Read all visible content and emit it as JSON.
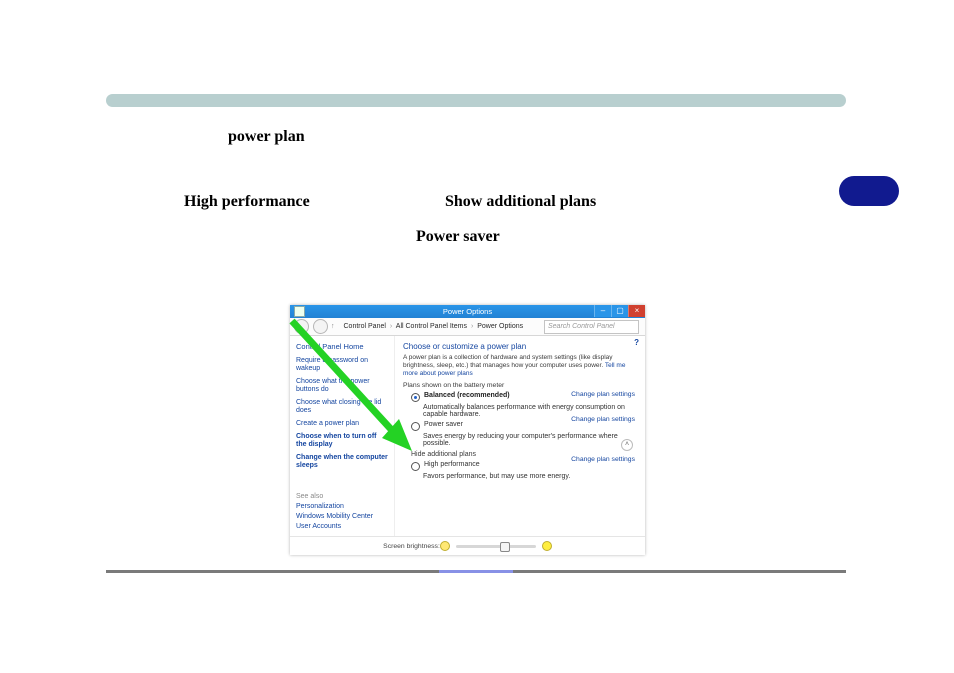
{
  "doc": {
    "line1": "power plan",
    "line2": "High performance",
    "line3": "Show additional plans",
    "line4": "Power saver"
  },
  "ss": {
    "title": "Power Options",
    "winbuttons": {
      "min": "–",
      "max": "▢",
      "close": "×"
    },
    "crumbs": {
      "root": "Control Panel",
      "mid": "All Control Panel Items",
      "leaf": "Power Options"
    },
    "search_placeholder": "Search Control Panel",
    "side": {
      "home": "Control Panel Home",
      "links": [
        "Require a password on wakeup",
        "Choose what the power buttons do",
        "Choose what closing the lid does",
        "Create a power plan",
        "Choose when to turn off the display",
        "Change when the computer sleeps"
      ],
      "see_also": "See also",
      "also_links": [
        "Personalization",
        "Windows Mobility Center",
        "User Accounts"
      ]
    },
    "main": {
      "heading": "Choose or customize a power plan",
      "desc_pre": "A power plan is a collection of hardware and system settings (like display brightness, sleep, etc.) that manages how your computer uses power. ",
      "desc_link": "Tell me more about power plans",
      "section1": "Plans shown on the battery meter",
      "plan_balanced": {
        "name": "Balanced (recommended)",
        "sub": "Automatically balances performance with energy consumption on capable hardware."
      },
      "plan_saver": {
        "name": "Power saver",
        "sub": "Saves energy by reducing your computer's performance where possible."
      },
      "hide_additional": "Hide additional plans",
      "plan_high": {
        "name": "High performance",
        "sub": "Favors performance, but may use more energy."
      },
      "change_settings": "Change plan settings"
    },
    "footer": {
      "label": "Screen brightness:"
    }
  }
}
